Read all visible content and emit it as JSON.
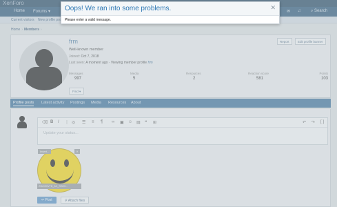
{
  "header": {
    "brand": "XenForo",
    "nav": [
      "Home",
      "Forums ▾"
    ],
    "nav_icons": [
      "envelope-icon",
      "bell-icon"
    ],
    "search_label": "Search",
    "subnav": [
      "Current visitors",
      "New profile posts"
    ]
  },
  "breadcrumb": {
    "items": [
      "Home",
      "Members"
    ],
    "current_index": 1
  },
  "profile": {
    "username": "frm",
    "title": "Well-known member",
    "joined_label": "Joined:",
    "joined_value": "Oct 7, 2018",
    "last_seen_label": "Last seen:",
    "last_seen_value": "A moment ago · Viewing member profile",
    "last_seen_link": "frm",
    "buttons": [
      "Report",
      "Edit profile banner"
    ],
    "find_label": "Find ▾",
    "stats": [
      {
        "label": "Messages",
        "value": "997"
      },
      {
        "label": "Media",
        "value": "5"
      },
      {
        "label": "Resources",
        "value": "2"
      },
      {
        "label": "Reaction score",
        "value": "581"
      },
      {
        "label": "Points",
        "value": "103"
      }
    ]
  },
  "tabs": [
    {
      "label": "Profile posts",
      "active": true
    },
    {
      "label": "Latest activity",
      "active": false
    },
    {
      "label": "Postings",
      "active": false
    },
    {
      "label": "Media",
      "active": false
    },
    {
      "label": "Resources",
      "active": false
    },
    {
      "label": "About",
      "active": false
    }
  ],
  "editor": {
    "placeholder": "Update your status...",
    "toolbar_icons": [
      "eraser-icon",
      "bold-icon",
      "italic-icon",
      "more-text-icon",
      "color-icon",
      "list-icon",
      "align-icon",
      "paragraph-icon",
      "link-icon",
      "image-icon",
      "emoji-icon",
      "media-icon",
      "quote-icon",
      "table-icon",
      "undo-icon",
      "redo-icon",
      "bbcode-icon"
    ],
    "attachment": {
      "tag": "Insert...",
      "close": "✕",
      "filename": "Z9bD9XVTD_AC_SW25..."
    },
    "post_label": "Post",
    "attach_label": "Attach files"
  },
  "dialog": {
    "title": "Oops! We ran into some problems.",
    "close": "✕",
    "message": "Please enter a valid message."
  },
  "colors": {
    "accent": "#2d6592",
    "dialog_title": "#2f79b5",
    "overlay": "#cdd4da"
  }
}
